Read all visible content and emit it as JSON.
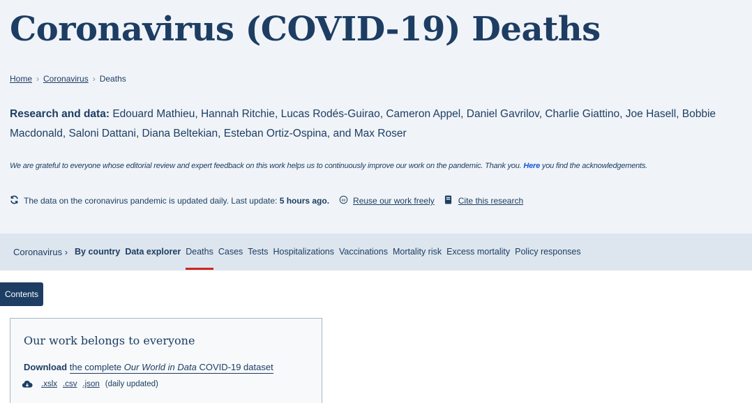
{
  "page": {
    "title": "Coronavirus (COVID-19) Deaths"
  },
  "breadcrumb": {
    "home": "Home",
    "coronavirus": "Coronavirus",
    "current": "Deaths",
    "separator": "›"
  },
  "authors": {
    "label": "Research and data:",
    "names": "Edouard Mathieu, Hannah Ritchie, Lucas Rodés-Guirao, Cameron Appel, Daniel Gavrilov, Charlie Giattino, Joe Hasell, Bobbie Macdonald, Saloni Dattani, Diana Beltekian, Esteban Ortiz-Ospina, and Max Roser"
  },
  "acknowledgement": {
    "before": "We are grateful to everyone whose editorial review and expert feedback on this work helps us to continuously improve our work on the pandemic. Thank you.",
    "link": "Here",
    "after": "you find the acknowledgements."
  },
  "update": {
    "icon": "refresh-icon",
    "text": "The data on the coronavirus pandemic is updated daily. Last update:",
    "time": "5 hours ago.",
    "reuse_icon": "creative-commons-icon",
    "reuse_link": "Reuse our work freely",
    "cite_icon": "book-icon",
    "cite_link": "Cite this research"
  },
  "subnav": {
    "root": "Coronavirus ›",
    "items": [
      {
        "label": "By country",
        "bold": true
      },
      {
        "label": "Data explorer",
        "bold": true
      },
      {
        "label": "Deaths",
        "active": true
      },
      {
        "label": "Cases"
      },
      {
        "label": "Tests"
      },
      {
        "label": "Hospitalizations"
      },
      {
        "label": "Vaccinations"
      },
      {
        "label": "Mortality risk"
      },
      {
        "label": "Excess mortality"
      },
      {
        "label": "Policy responses"
      }
    ]
  },
  "contents_button": "Contents",
  "card": {
    "title": "Our work belongs to everyone",
    "download_label": "Download",
    "download_link_before": "the complete",
    "download_link_italic": "Our World in Data",
    "download_link_after": "COVID-19 dataset",
    "cloud_icon": "cloud-download-icon",
    "formats": [
      ".xslx",
      ".csv",
      ".json"
    ],
    "note": "(daily updated)"
  },
  "colors": {
    "primary": "#1d3d63",
    "header_bg": "#f0f4f8",
    "subnav_bg": "#dde6ee",
    "active_underline": "#ce261e",
    "link_blue": "#1557d6"
  }
}
